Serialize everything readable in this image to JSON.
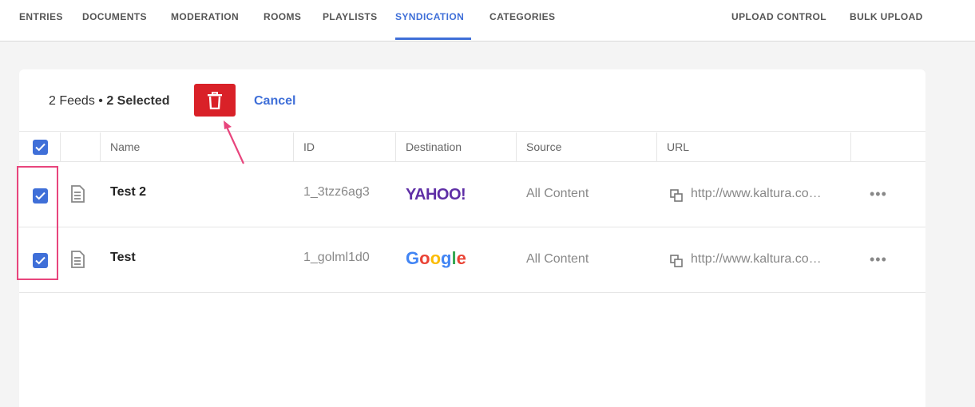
{
  "nav": {
    "items": [
      "ENTRIES",
      "DOCUMENTS",
      "MODERATION",
      "ROOMS",
      "PLAYLISTS",
      "SYNDICATION",
      "CATEGORIES"
    ],
    "active": "SYNDICATION",
    "right_items": [
      "UPLOAD CONTROL",
      "BULK UPLOAD"
    ]
  },
  "bulk": {
    "feeds_count": "2 Feeds",
    "bullet": "•",
    "selected": "2 Selected",
    "cancel_label": "Cancel"
  },
  "table": {
    "headers": [
      "Name",
      "ID",
      "Destination",
      "Source",
      "URL"
    ],
    "rows": [
      {
        "name": "Test 2",
        "id": "1_3tzz6ag3",
        "destination": "YAHOO!",
        "source": "All Content",
        "url": "http://www.kaltura.co…",
        "checked": true
      },
      {
        "name": "Test",
        "id": "1_golml1d0",
        "destination": "Google",
        "source": "All Content",
        "url": "http://www.kaltura.co…",
        "checked": true
      }
    ],
    "more_label": "•••"
  },
  "icons": {
    "delete": "trash-icon",
    "doc": "document-icon",
    "link": "copy-link-icon",
    "check": "checkmark-icon"
  },
  "colors": {
    "accent": "#3f6fd8",
    "danger": "#d92128",
    "annotation": "#e8457d",
    "yahoo": "#5f2fa6"
  }
}
